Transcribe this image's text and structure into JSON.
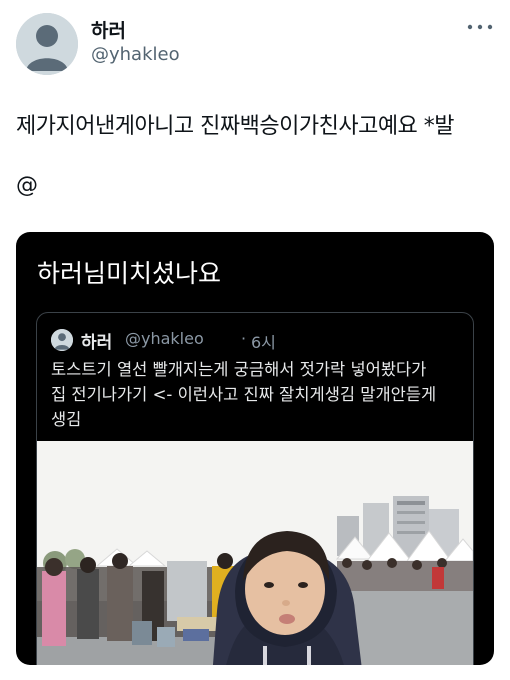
{
  "tweet": {
    "author_name": "하러",
    "author_handle": "@yhakleo",
    "avatar_icon": "default-profile-avatar-icon",
    "more_icon": "more-options-icon",
    "text": "제가지어낸게아니고 진짜백승이가친사고예요 *발",
    "mention": "@"
  },
  "media_card": {
    "caption": "하러님미치셨나요",
    "quote": {
      "author_name": "하러",
      "author_handle": "@yhakleo",
      "separator": "·",
      "time": "6시",
      "text": "토스트기 열선 빨개지는게 궁금해서 젓가락 넣어봤다가\n집 전기나가기 <- 이런사고 진짜 잘치게생김 말개안듣게\n생김",
      "photo_description_icon": "photo-child-in-hoodie"
    }
  },
  "colors": {
    "text_primary": "#0f1419",
    "text_secondary": "#536471",
    "card_background": "#000000",
    "quote_border": "#3b4248"
  }
}
